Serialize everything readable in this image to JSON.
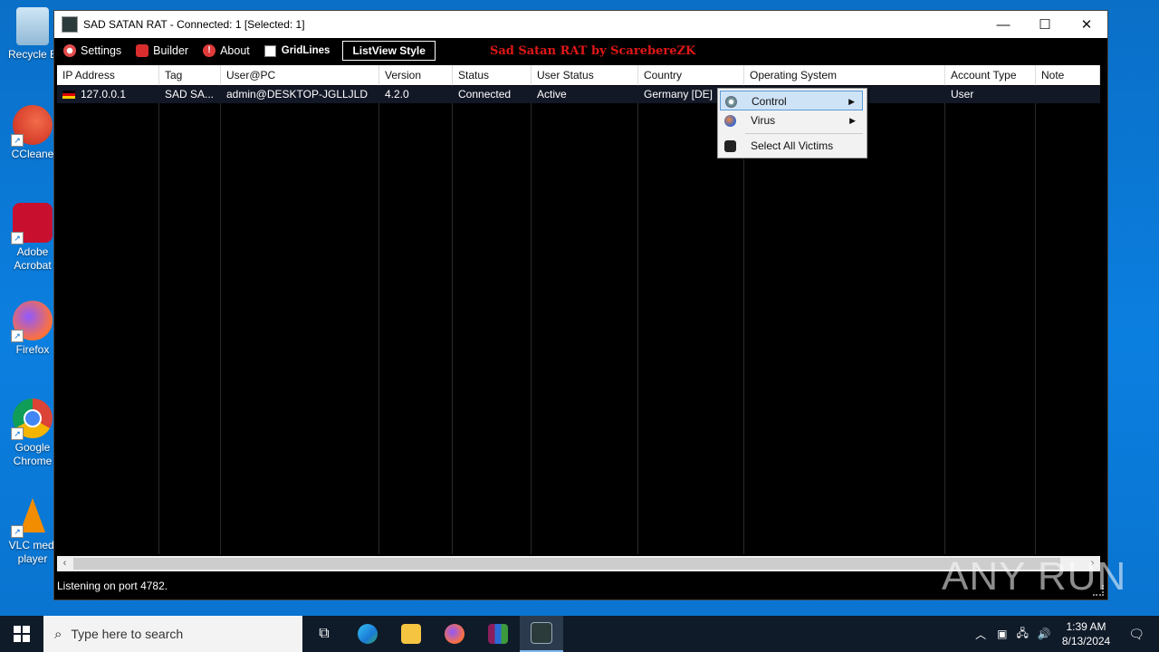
{
  "desktop": {
    "icons": [
      {
        "label": "Recycle Bin",
        "display": "Recycle B"
      },
      {
        "label": "CCleaner",
        "display": "CCleane"
      },
      {
        "label": "Adobe Acrobat",
        "display": "Adobe Acrobat"
      },
      {
        "label": "Firefox",
        "display": "Firefox"
      },
      {
        "label": "Google Chrome",
        "display": "Google Chrome"
      },
      {
        "label": "VLC media player",
        "display": "VLC medi player"
      }
    ]
  },
  "window": {
    "title": "SAD SATAN RAT - Connected: 1 [Selected: 1]",
    "controls": {
      "minimize": "—",
      "maximize": "☐",
      "close": "✕"
    }
  },
  "toolbar": {
    "settings": "Settings",
    "builder": "Builder",
    "about": "About",
    "gridlines": "GridLines",
    "listview_style": "ListView Style",
    "banner": "Sad Satan RAT by ScarebereZK"
  },
  "columns": [
    "IP Address",
    "Tag",
    "User@PC",
    "Version",
    "Status",
    "User Status",
    "Country",
    "Operating System",
    "Account Type",
    "Note"
  ],
  "rows": [
    {
      "ip": "127.0.0.1",
      "tag": "SAD SA...",
      "user_pc": "admin@DESKTOP-JGLLJLD",
      "version": "4.2.0",
      "status": "Connected",
      "user_status": "Active",
      "country": "Germany [DE]",
      "os": "",
      "account_type": "User",
      "note": ""
    }
  ],
  "context_menu": {
    "items": [
      {
        "label": "Control",
        "has_submenu": true,
        "selected": true
      },
      {
        "label": "Virus",
        "has_submenu": true,
        "selected": false
      },
      {
        "label": "Select All Victims",
        "has_submenu": false,
        "selected": false
      }
    ]
  },
  "status_bar": {
    "text": "Listening on port 4782."
  },
  "watermark": "ANY RUN",
  "taskbar": {
    "search_placeholder": "Type here to search",
    "time": "1:39 AM",
    "date": "8/13/2024"
  }
}
